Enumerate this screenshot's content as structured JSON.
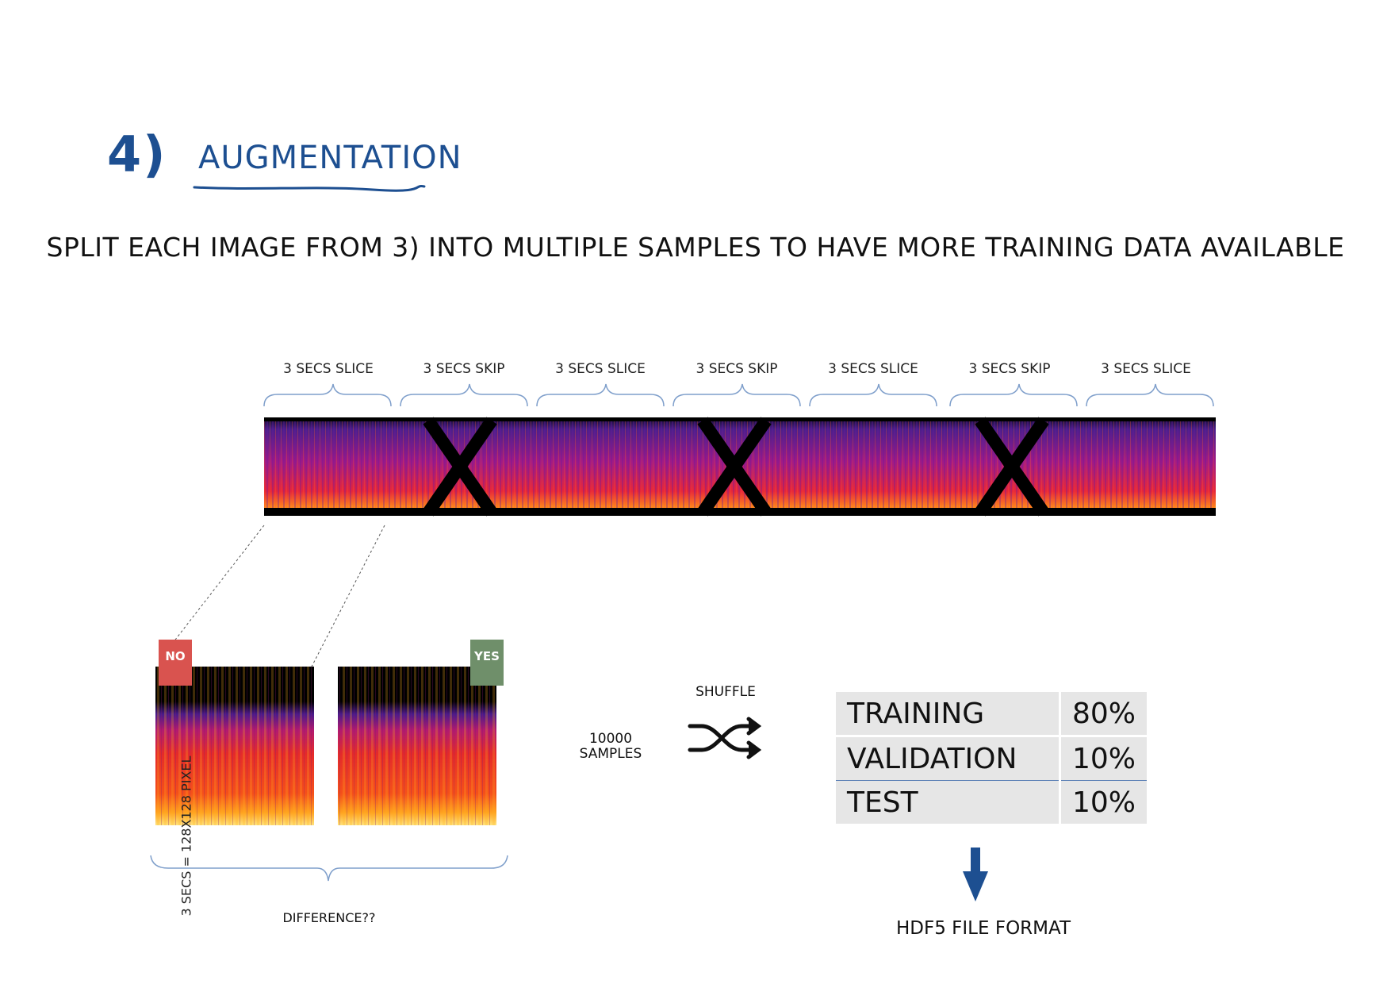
{
  "heading": {
    "number": "4)",
    "title": "AUGMENTATION"
  },
  "subtitle": "SPLIT EACH IMAGE FROM 3) INTO MULTIPLE SAMPLES TO HAVE MORE TRAINING DATA AVAILABLE",
  "segments": [
    {
      "label": "3 SECS SLICE",
      "type": "slice"
    },
    {
      "label": "3 SECS SKIP",
      "type": "skip"
    },
    {
      "label": "3 SECS SLICE",
      "type": "slice"
    },
    {
      "label": "3 SECS SKIP",
      "type": "skip"
    },
    {
      "label": "3 SECS SLICE",
      "type": "slice"
    },
    {
      "label": "3 SECS SKIP",
      "type": "skip"
    },
    {
      "label": "3 SECS SLICE",
      "type": "slice"
    }
  ],
  "sample_note": "3 SECS = 128X128 PIXEL",
  "votes": {
    "left": "NO",
    "right": "YES"
  },
  "difference_label": "DIFFERENCE??",
  "samples_count": "10000",
  "samples_label": "SAMPLES",
  "shuffle_label": "SHUFFLE",
  "split": [
    {
      "name": "TRAINING",
      "percent": "80%"
    },
    {
      "name": "VALIDATION",
      "percent": "10%"
    },
    {
      "name": "TEST",
      "percent": "10%"
    }
  ],
  "output_format": "HDF5 FILE FORMAT",
  "colors": {
    "accent": "#1d4f91",
    "brace": "#7f9fcb",
    "no_badge": "#d9534f",
    "yes_badge": "#6f8f6a",
    "table_bg": "#e6e6e6"
  },
  "icons": {
    "shuffle": "shuffle-icon",
    "arrow": "arrow-down-icon"
  }
}
